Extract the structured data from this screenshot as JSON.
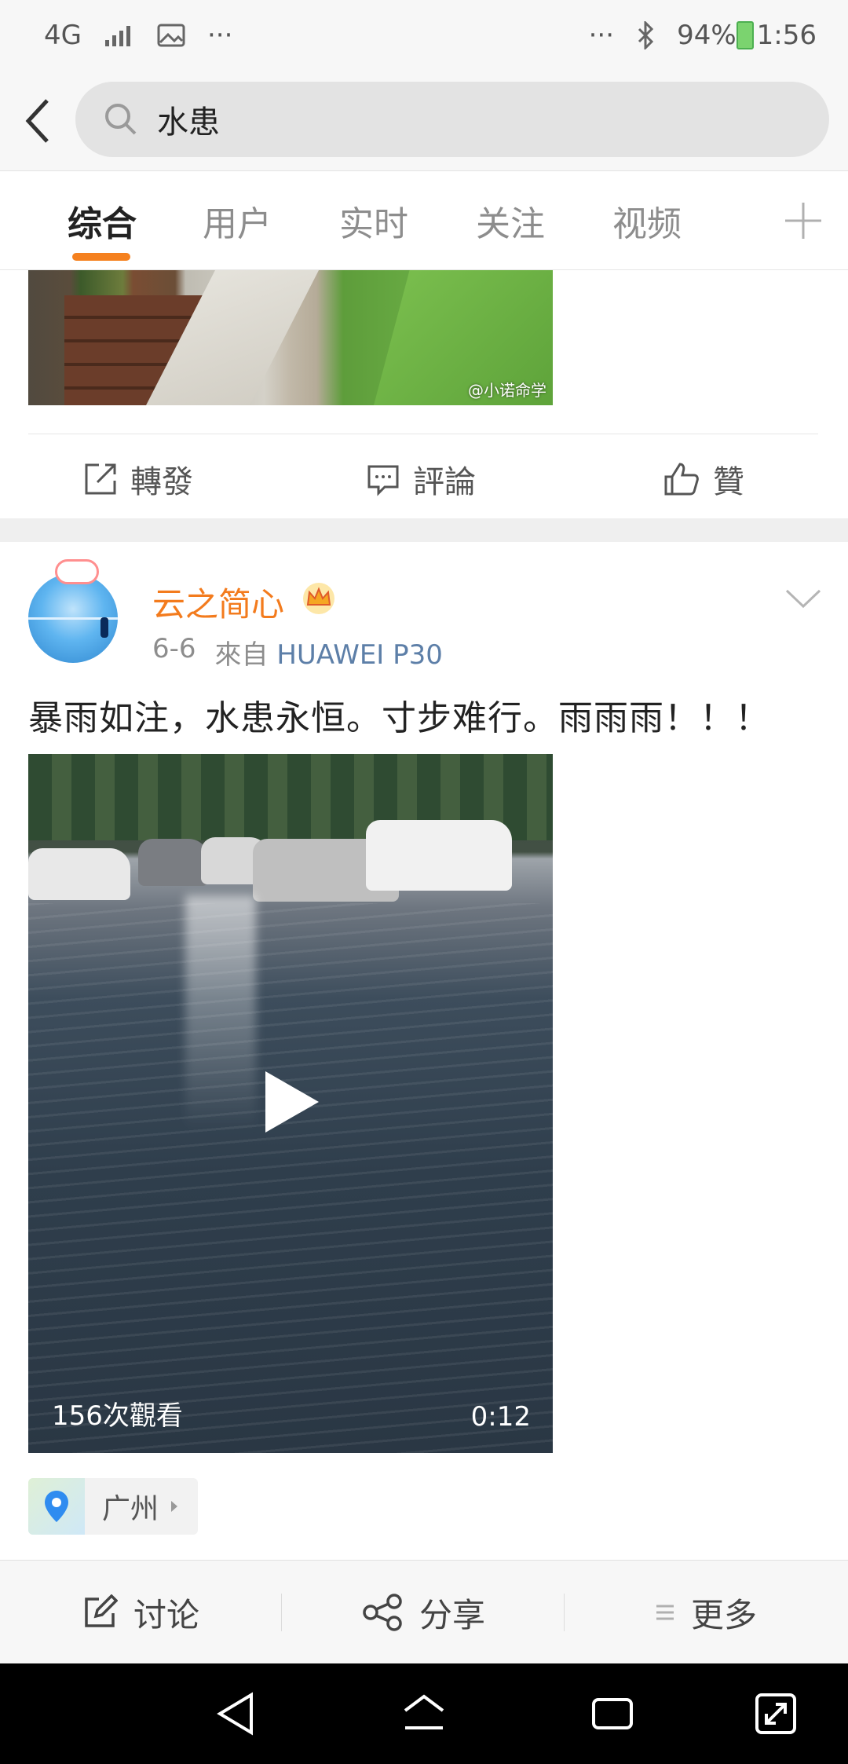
{
  "status_bar": {
    "network": "4G",
    "battery": "94%",
    "time": "1:56",
    "more": "···"
  },
  "search": {
    "query": "水患"
  },
  "tabs": [
    {
      "label": "综合",
      "active": true
    },
    {
      "label": "用户",
      "active": false
    },
    {
      "label": "实时",
      "active": false
    },
    {
      "label": "关注",
      "active": false
    },
    {
      "label": "视频",
      "active": false
    }
  ],
  "post1": {
    "watermark": "@小诺命学",
    "actions": {
      "repost": "轉發",
      "comment": "評論",
      "like": "贊"
    }
  },
  "post2": {
    "username": "云之简心",
    "date": "6-6",
    "source_prefix": "來自",
    "source": "HUAWEI P30",
    "text": "暴雨如注，水患永恒。寸步难行。雨雨雨！！！",
    "video": {
      "views": "156次觀看",
      "duration": "0:12"
    },
    "location": "广州"
  },
  "bottom_bar": {
    "discuss": "讨论",
    "share": "分享",
    "more": "更多"
  },
  "colors": {
    "accent": "#f5811f",
    "username": "#f37b1d",
    "source_link": "#5d7fa8"
  }
}
